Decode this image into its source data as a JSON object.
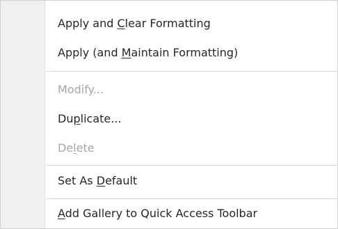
{
  "menu": {
    "items": [
      {
        "pre": "Apply and ",
        "key": "C",
        "post": "lear Formatting",
        "enabled": true
      },
      {
        "pre": "Apply (and ",
        "key": "M",
        "post": "aintain Formatting)",
        "enabled": true
      },
      {
        "pre": "Modif",
        "key": "y",
        "post": "...",
        "enabled": false
      },
      {
        "pre": "Du",
        "key": "p",
        "post": "licate...",
        "enabled": true
      },
      {
        "pre": "De",
        "key": "l",
        "post": "ete",
        "enabled": false
      },
      {
        "pre": "Set As ",
        "key": "D",
        "post": "efault",
        "enabled": true
      },
      {
        "pre": "",
        "key": "A",
        "post": "dd Gallery to Quick Access Toolbar",
        "enabled": true
      }
    ]
  },
  "colors": {
    "text": "#262626",
    "disabled_text": "#a6a6a6",
    "gutter": "#f0f0f0",
    "separator": "#d6d6d6"
  }
}
